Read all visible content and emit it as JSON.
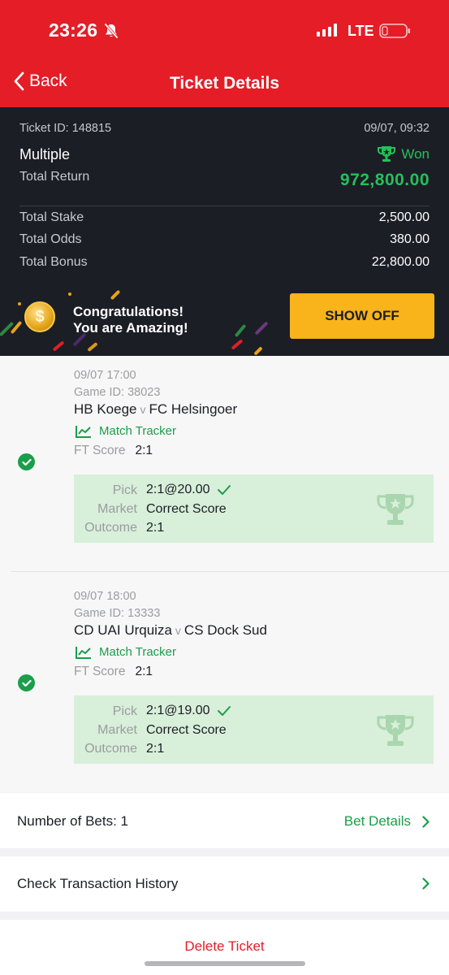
{
  "status_bar": {
    "time": "23:26",
    "network": "LTE"
  },
  "nav": {
    "back_label": "Back",
    "title": "Ticket Details"
  },
  "ticket": {
    "id_label": "Ticket ID: 148815",
    "datetime": "09/07, 09:32",
    "bet_type": "Multiple",
    "status": "Won",
    "total_return_label": "Total Return",
    "total_return": "972,800.00",
    "rows": [
      {
        "label": "Total Stake",
        "value": "2,500.00"
      },
      {
        "label": "Total Odds",
        "value": "380.00"
      },
      {
        "label": "Total Bonus",
        "value": "22,800.00"
      }
    ],
    "status_color": "#24c05a"
  },
  "banner": {
    "line1": "Congratulations!",
    "line2": "You are Amazing!",
    "coin_symbol": "$",
    "button": "SHOW OFF",
    "button_color": "#f9b31b"
  },
  "selections": [
    {
      "time": "09/07 17:00",
      "game_id": "Game ID: 38023",
      "home": "HB Koege",
      "vs": "v",
      "away": "FC Helsingoer",
      "tracker": "Match Tracker",
      "ft_label": "FT Score",
      "ft_score": "2:1",
      "pick_label": "Pick",
      "pick": "2:1@20.00",
      "market_label": "Market",
      "market": "Correct Score",
      "outcome_label": "Outcome",
      "outcome": "2:1"
    },
    {
      "time": "09/07 18:00",
      "game_id": "Game ID: 13333",
      "home": "CD UAI Urquiza",
      "vs": "v",
      "away": "CS Dock Sud",
      "tracker": "Match Tracker",
      "ft_label": "FT Score",
      "ft_score": "2:1",
      "pick_label": "Pick",
      "pick": "2:1@19.00",
      "market_label": "Market",
      "market": "Correct Score",
      "outcome_label": "Outcome",
      "outcome": "2:1"
    }
  ],
  "bets": {
    "label": "Number of Bets: 1",
    "link": "Bet Details"
  },
  "history": {
    "label": "Check Transaction History"
  },
  "delete_label": "Delete Ticket",
  "colors": {
    "brand_red": "#e41d27",
    "dark": "#1c1e26",
    "green": "#1a9e4a",
    "pick_bg": "#d8efd9"
  },
  "icons": [
    "back-chevron-icon",
    "bell-muted-icon",
    "signal-icon",
    "battery-icon",
    "trophy-icon",
    "coin-icon",
    "check-circle-icon",
    "tick-icon",
    "chart-icon",
    "chevron-right-icon"
  ]
}
